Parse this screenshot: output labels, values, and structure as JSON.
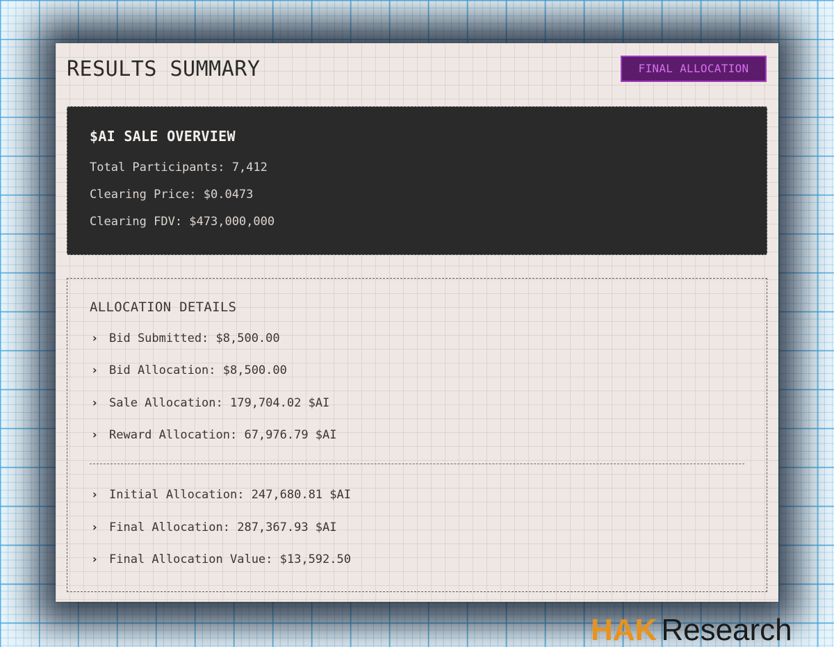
{
  "header": {
    "title": "RESULTS SUMMARY",
    "badge": "FINAL ALLOCATION"
  },
  "overview": {
    "title": "$AI SALE OVERVIEW",
    "lines": [
      "Total Participants: 7,412",
      "Clearing Price: $0.0473",
      "Clearing FDV: $473,000,000"
    ]
  },
  "details": {
    "title": "ALLOCATION DETAILS",
    "bullet": "›",
    "items": [
      "Bid Submitted: $8,500.00",
      "Bid Allocation: $8,500.00",
      "Sale Allocation: 179,704.02 $AI",
      "Reward Allocation: 67,976.79 $AI"
    ],
    "totals": [
      "Initial Allocation: 247,680.81 $AI",
      "Final Allocation: 287,367.93 $AI",
      "Final Allocation Value: $13,592.50"
    ]
  },
  "watermark": {
    "brand": "HAK",
    "text": "Research"
  },
  "colors": {
    "badge_bg": "#5c1c6b",
    "badge_text": "#d670ee",
    "panel_dark": "#2a2a2a",
    "card_bg": "#efe7e3",
    "brand_orange": "#e8931f",
    "grid_blue": "#46aae1"
  }
}
